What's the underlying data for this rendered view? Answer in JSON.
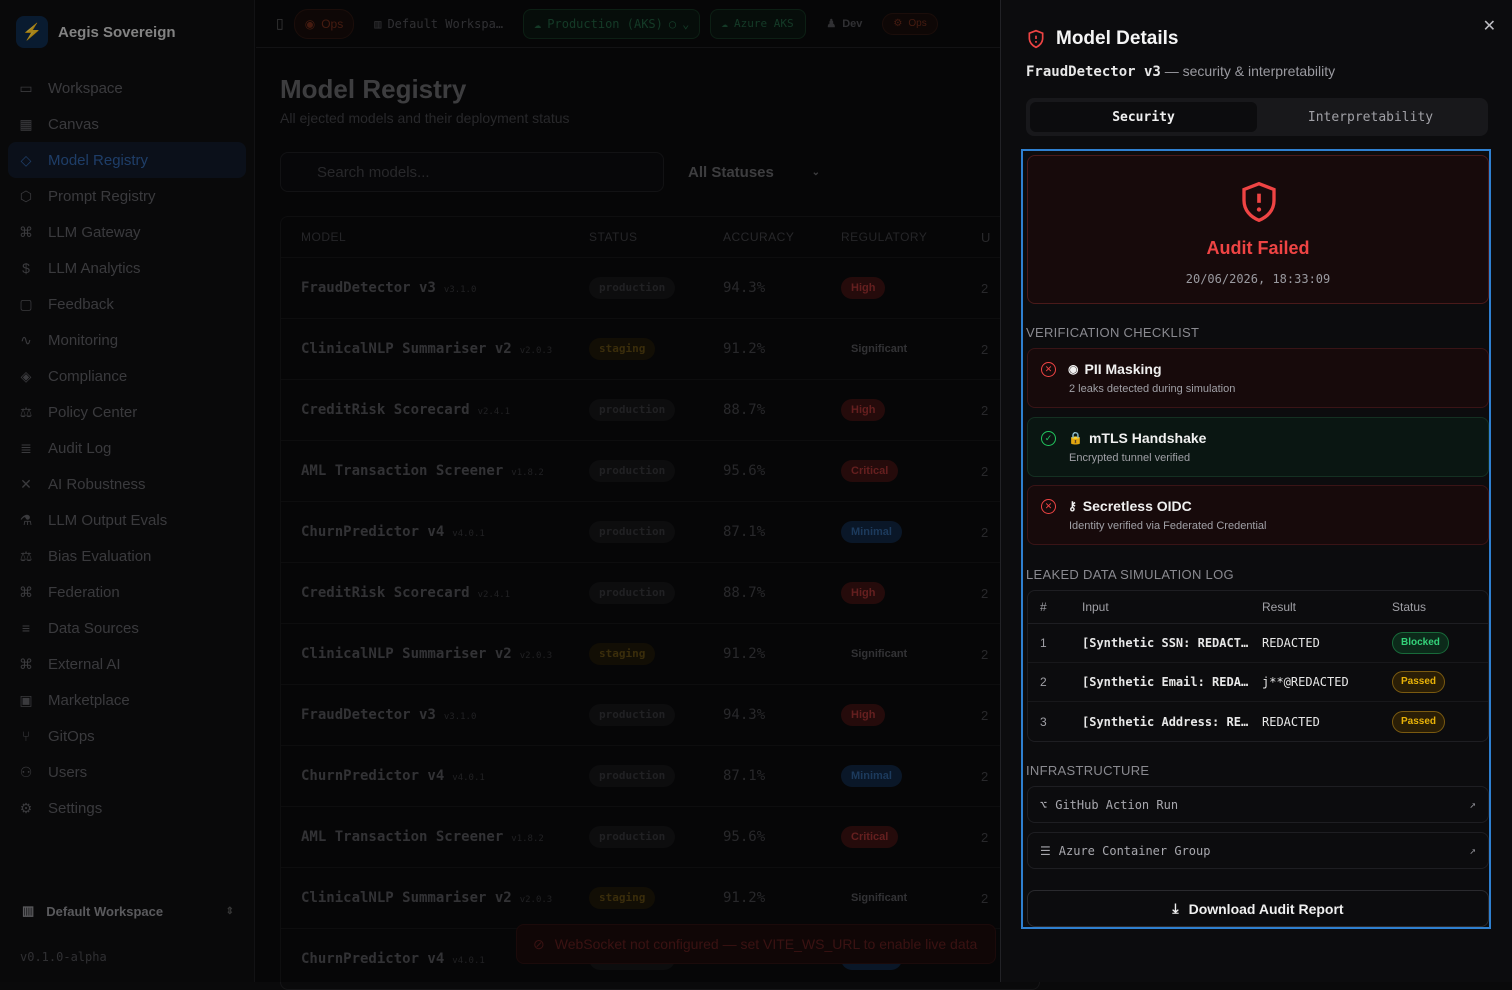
{
  "brand": {
    "name": "Aegis Sovereign"
  },
  "sidebar": {
    "items": [
      {
        "label": "Workspace",
        "icon": "folder-icon",
        "glyph": "▭"
      },
      {
        "label": "Canvas",
        "icon": "grid-icon",
        "glyph": "▦"
      },
      {
        "label": "Model Registry",
        "icon": "box-icon",
        "glyph": "◇",
        "active": true
      },
      {
        "label": "Prompt Registry",
        "icon": "hexagon-icon",
        "glyph": "⬡"
      },
      {
        "label": "LLM Gateway",
        "icon": "network-icon",
        "glyph": "⌘"
      },
      {
        "label": "LLM Analytics",
        "icon": "dollar-icon",
        "glyph": "$"
      },
      {
        "label": "Feedback",
        "icon": "message-icon",
        "glyph": "▢"
      },
      {
        "label": "Monitoring",
        "icon": "activity-icon",
        "glyph": "∿"
      },
      {
        "label": "Compliance",
        "icon": "shield-icon",
        "glyph": "◈"
      },
      {
        "label": "Policy Center",
        "icon": "scale-icon",
        "glyph": "⚖"
      },
      {
        "label": "Audit Log",
        "icon": "scroll-icon",
        "glyph": "≣"
      },
      {
        "label": "AI Robustness",
        "icon": "crosshair-icon",
        "glyph": "✕"
      },
      {
        "label": "LLM Output Evals",
        "icon": "flask-icon",
        "glyph": "⚗"
      },
      {
        "label": "Bias Evaluation",
        "icon": "balance-icon",
        "glyph": "⚖"
      },
      {
        "label": "Federation",
        "icon": "nodes-icon",
        "glyph": "⌘"
      },
      {
        "label": "Data Sources",
        "icon": "database-icon",
        "glyph": "≡"
      },
      {
        "label": "External AI",
        "icon": "link-icon",
        "glyph": "⌘"
      },
      {
        "label": "Marketplace",
        "icon": "store-icon",
        "glyph": "▣"
      },
      {
        "label": "GitOps",
        "icon": "git-icon",
        "glyph": "⑂"
      },
      {
        "label": "Users",
        "icon": "users-icon",
        "glyph": "⚇"
      },
      {
        "label": "Settings",
        "icon": "gear-icon",
        "glyph": "⚙"
      }
    ],
    "workspace": "Default Workspace",
    "version": "v0.1.0-alpha"
  },
  "topbar": {
    "ops": "Ops",
    "workspace": "Default Workspa…",
    "env": "Production (AKS)",
    "cloud": "Azure AKS",
    "dev": "Dev",
    "ops2": "Ops"
  },
  "main": {
    "title": "Model Registry",
    "subtitle": "All ejected models and their deployment status",
    "search_placeholder": "Search models...",
    "status_filter": "All Statuses",
    "columns": [
      "MODEL",
      "STATUS",
      "ACCURACY",
      "REGULATORY",
      "U"
    ],
    "rows": [
      {
        "name": "FraudDetector v3",
        "ver": "v3.1.0",
        "status": "production",
        "acc": "94.3%",
        "reg": "High"
      },
      {
        "name": "ClinicalNLP Summariser v2",
        "ver": "v2.0.3",
        "status": "staging",
        "acc": "91.2%",
        "reg": "Significant"
      },
      {
        "name": "CreditRisk Scorecard",
        "ver": "v2.4.1",
        "status": "production",
        "acc": "88.7%",
        "reg": "High"
      },
      {
        "name": "AML Transaction Screener",
        "ver": "v1.8.2",
        "status": "production",
        "acc": "95.6%",
        "reg": "Critical"
      },
      {
        "name": "ChurnPredictor v4",
        "ver": "v4.0.1",
        "status": "production",
        "acc": "87.1%",
        "reg": "Minimal"
      },
      {
        "name": "CreditRisk Scorecard",
        "ver": "v2.4.1",
        "status": "production",
        "acc": "88.7%",
        "reg": "High"
      },
      {
        "name": "ClinicalNLP Summariser v2",
        "ver": "v2.0.3",
        "status": "staging",
        "acc": "91.2%",
        "reg": "Significant"
      },
      {
        "name": "FraudDetector v3",
        "ver": "v3.1.0",
        "status": "production",
        "acc": "94.3%",
        "reg": "High"
      },
      {
        "name": "ChurnPredictor v4",
        "ver": "v4.0.1",
        "status": "production",
        "acc": "87.1%",
        "reg": "Minimal"
      },
      {
        "name": "AML Transaction Screener",
        "ver": "v1.8.2",
        "status": "production",
        "acc": "95.6%",
        "reg": "Critical"
      },
      {
        "name": "ClinicalNLP Summariser v2",
        "ver": "v2.0.3",
        "status": "staging",
        "acc": "91.2%",
        "reg": "Significant"
      },
      {
        "name": "ChurnPredictor v4",
        "ver": "v4.0.1",
        "status": "production",
        "acc": "87.1%",
        "reg": "Minimal"
      }
    ],
    "toast": "WebSocket not configured — set VITE_WS_URL to enable live data"
  },
  "drawer": {
    "title": "Model Details",
    "model": "FraudDetector v3",
    "subtitle": "— security & interpretability",
    "tabs": [
      "Security",
      "Interpretability"
    ],
    "audit": {
      "status": "Audit Failed",
      "timestamp": "20/06/2026, 18:33:09"
    },
    "checklist_label": "VERIFICATION CHECKLIST",
    "checks": [
      {
        "name": "PII Masking",
        "desc": "2 leaks detected during simulation",
        "state": "fail",
        "icon": "eye-icon",
        "glyph": "◉"
      },
      {
        "name": "mTLS Handshake",
        "desc": "Encrypted tunnel verified",
        "state": "pass",
        "icon": "lock-icon",
        "glyph": "🔒"
      },
      {
        "name": "Secretless OIDC",
        "desc": "Identity verified via Federated Credential",
        "state": "fail",
        "icon": "key-icon",
        "glyph": "⚷"
      }
    ],
    "log_label": "LEAKED DATA SIMULATION LOG",
    "log_columns": [
      "#",
      "Input",
      "Result",
      "Status"
    ],
    "log_rows": [
      {
        "num": "1",
        "input": "[Synthetic SSN: REDACTED]",
        "result": "REDACTED",
        "status": "Blocked"
      },
      {
        "num": "2",
        "input": "[Synthetic Email: REDACTED]",
        "result": "j**@REDACTED",
        "status": "Passed"
      },
      {
        "num": "3",
        "input": "[Synthetic Address: REDACTED]",
        "result": "REDACTED",
        "status": "Passed"
      }
    ],
    "infra_label": "INFRASTRUCTURE",
    "infra": [
      {
        "label": "GitHub Action Run",
        "icon": "github-icon"
      },
      {
        "label": "Azure Container Group",
        "icon": "server-icon"
      }
    ],
    "download": "Download Audit Report"
  }
}
